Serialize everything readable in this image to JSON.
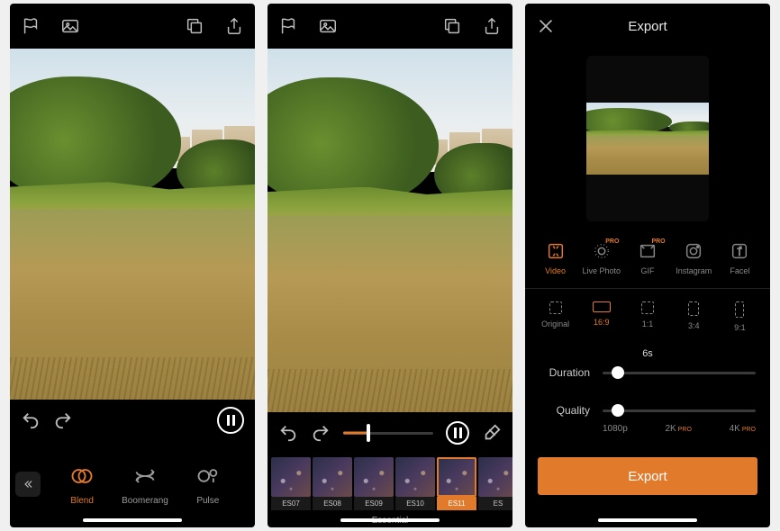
{
  "screen1": {
    "topIcons": [
      "flag-icon",
      "image-icon",
      "copy-icon",
      "share-icon"
    ],
    "modes": [
      {
        "id": "blend",
        "label": "Blend",
        "active": true
      },
      {
        "id": "boomerang",
        "label": "Boomerang",
        "active": false
      },
      {
        "id": "pulse",
        "label": "Pulse",
        "active": false
      }
    ]
  },
  "screen2": {
    "progressPercent": 28,
    "filters": [
      {
        "id": "es07",
        "label": "ES07",
        "active": false
      },
      {
        "id": "es08",
        "label": "ES08",
        "active": false
      },
      {
        "id": "es09",
        "label": "ES09",
        "active": false
      },
      {
        "id": "es10",
        "label": "ES10",
        "active": false
      },
      {
        "id": "es11",
        "label": "ES11",
        "active": true
      },
      {
        "id": "es12",
        "label": "ES",
        "active": false
      }
    ],
    "categoryLabel": "Essential"
  },
  "screen3": {
    "title": "Export",
    "destinations": [
      {
        "id": "video",
        "label": "Video",
        "active": true,
        "pro": false
      },
      {
        "id": "livephoto",
        "label": "Live Photo",
        "active": false,
        "pro": true
      },
      {
        "id": "gif",
        "label": "GIF",
        "active": false,
        "pro": true
      },
      {
        "id": "instagram",
        "label": "Instagram",
        "active": false,
        "pro": false
      },
      {
        "id": "facebook",
        "label": "Facel",
        "active": false,
        "pro": false
      }
    ],
    "proBadge": "PRO",
    "ratios": [
      {
        "id": "original",
        "label": "Original",
        "w": 14,
        "h": 14,
        "active": false
      },
      {
        "id": "16-9",
        "label": "16:9",
        "w": 20,
        "h": 12,
        "active": true
      },
      {
        "id": "1-1",
        "label": "1:1",
        "w": 14,
        "h": 14,
        "active": false
      },
      {
        "id": "3-4",
        "label": "3:4",
        "w": 12,
        "h": 16,
        "active": false
      },
      {
        "id": "9-16",
        "label": "9:1",
        "w": 10,
        "h": 18,
        "active": false
      }
    ],
    "duration": {
      "label": "Duration",
      "valueLabel": "6s",
      "percent": 10
    },
    "quality": {
      "label": "Quality",
      "percent": 10,
      "ticks": [
        {
          "label": "1080p",
          "pro": false
        },
        {
          "label": "2K",
          "pro": true
        },
        {
          "label": "4K",
          "pro": true
        }
      ]
    },
    "exportButton": "Export"
  }
}
